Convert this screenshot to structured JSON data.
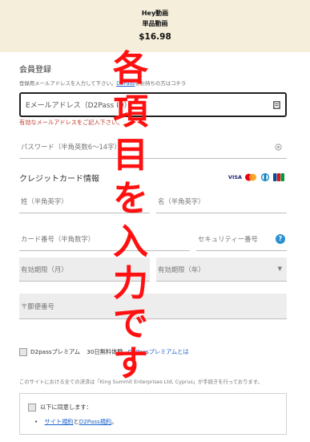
{
  "product": {
    "name": "Hey動画",
    "type": "単品動画",
    "price": "$16.98"
  },
  "registration": {
    "title": "会員登録",
    "instruction": "登録用メールアドレスを入力して下さい。",
    "d2pass_link": "D2Pass",
    "login_prompt": "をお持ちの方はコチラ",
    "email": {
      "placeholder": "Eメールアドレス（D2Pass ID）",
      "icon": "contact-card-icon"
    },
    "email_error": "有効なメールアドレスをご記入下さい。",
    "password": {
      "placeholder": "パスワード（半角英数6～14字）",
      "icon": "eye-icon"
    }
  },
  "credit_card": {
    "title": "クレジットカード情報",
    "logos": [
      "VISA",
      "Mastercard",
      "Diners",
      "JCB"
    ],
    "last_name": {
      "placeholder": "姓（半角英字）"
    },
    "first_name": {
      "placeholder": "名（半角英字）"
    },
    "card_number": {
      "placeholder": "カード番号（半角数字）"
    },
    "security_code": {
      "placeholder": "セキュリティー番号",
      "help": "?"
    },
    "expiry_month": {
      "placeholder": "有効期限（月）"
    },
    "expiry_year": {
      "placeholder": "有効期限（年）",
      "arrow": "▼"
    },
    "postal_code": {
      "placeholder": "〒郵便番号"
    }
  },
  "premium": {
    "label": "D2passプレミアム",
    "trial": "30日無料",
    "trial_suffix": "体験",
    "link": "D2Passプレミアムとは"
  },
  "notice": "このサイトにおける全ての決済は「King Summit Enterprises Ltd, Cyprus」が手続きを行っております。",
  "agreement": {
    "label": "以下に同意します：",
    "site_terms": "サイト規約",
    "and": "と",
    "d2pass_terms": "D2Pass規約",
    "end": "。"
  },
  "overlay_text": "各項目を入力です",
  "colors": {
    "overlay": "#ff1010",
    "link": "#1a63c8",
    "error": "#c0392b",
    "header_bg": "#f5eedb"
  }
}
